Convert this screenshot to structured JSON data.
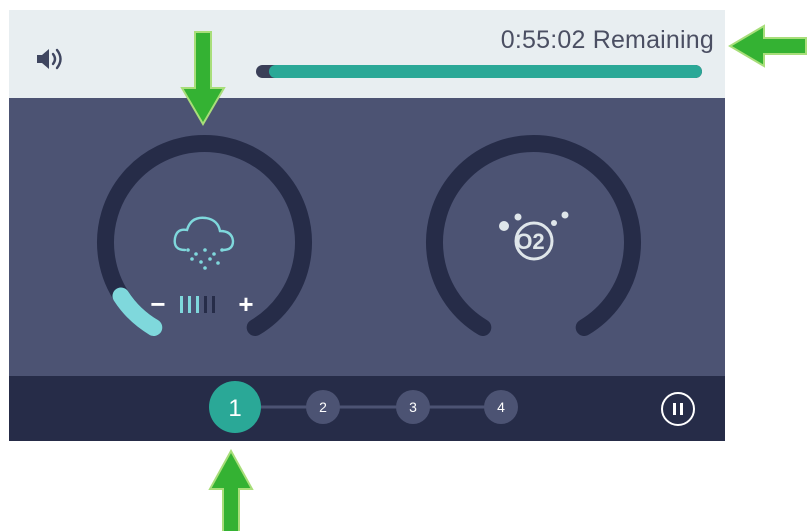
{
  "topbar": {
    "time_remaining": "0:55:02 Remaining",
    "progress": 0.97,
    "volume_icon": "speaker-volume-icon"
  },
  "dials": {
    "mist": {
      "icon": "mist-cloud-icon",
      "minus_label": "−",
      "plus_label": "+",
      "level_segments": 5,
      "level_active": 3
    },
    "oxygen": {
      "icon": "o2-bubbles-icon",
      "label": "O2"
    }
  },
  "steps": {
    "items": [
      "1",
      "2",
      "3",
      "4"
    ],
    "active_index": 0
  },
  "pause_icon": "pause-icon",
  "colors": {
    "screen_bg": "#4c5373",
    "topbar_bg": "#e8eef1",
    "bottombar_bg": "#262c48",
    "ring": "#262c48",
    "accent_teal": "#2aa897",
    "mist_cyan": "#7fd8dc",
    "arrow_green": "#34b233"
  }
}
